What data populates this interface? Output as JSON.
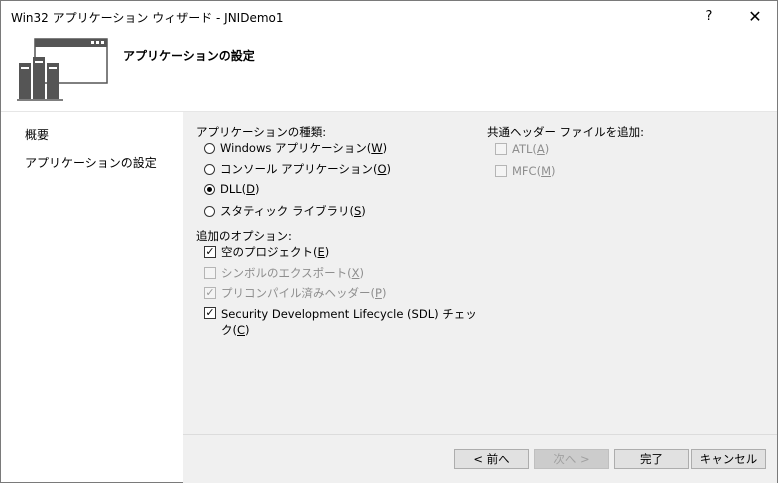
{
  "window": {
    "title": "Win32 アプリケーション ウィザード - JNIDemo1",
    "help": "?",
    "close": "✕"
  },
  "header": {
    "title": "アプリケーションの設定"
  },
  "nav": {
    "items": [
      {
        "label": "概要"
      },
      {
        "label": "アプリケーションの設定"
      }
    ]
  },
  "app_type": {
    "label": "アプリケーションの種類:",
    "options": [
      {
        "text": "Windows アプリケーション",
        "key": "W",
        "selected": false
      },
      {
        "text": "コンソール アプリケーション",
        "key": "O",
        "selected": false
      },
      {
        "text": "DLL",
        "key": "D",
        "selected": true
      },
      {
        "text": "スタティック ライブラリ",
        "key": "S",
        "selected": false
      }
    ]
  },
  "extra": {
    "label": "追加のオプション:",
    "options": [
      {
        "text": "空のプロジェクト",
        "key": "E",
        "checked": true,
        "enabled": true
      },
      {
        "text": "シンボルのエクスポート",
        "key": "X",
        "checked": false,
        "enabled": false
      },
      {
        "text": "プリコンパイル済みヘッダー",
        "key": "P",
        "checked": true,
        "enabled": false
      },
      {
        "text": "Security Development Lifecycle (SDL) チェッ",
        "text2": "ク",
        "key": "C",
        "checked": true,
        "enabled": true
      }
    ]
  },
  "common_header": {
    "label": "共通ヘッダー ファイルを追加:",
    "options": [
      {
        "text": "ATL",
        "key": "A",
        "checked": false,
        "enabled": false
      },
      {
        "text": "MFC",
        "key": "M",
        "checked": false,
        "enabled": false
      }
    ]
  },
  "buttons": {
    "prev": "< 前へ",
    "next": "次へ >",
    "finish": "完了",
    "cancel": "キャンセル"
  }
}
